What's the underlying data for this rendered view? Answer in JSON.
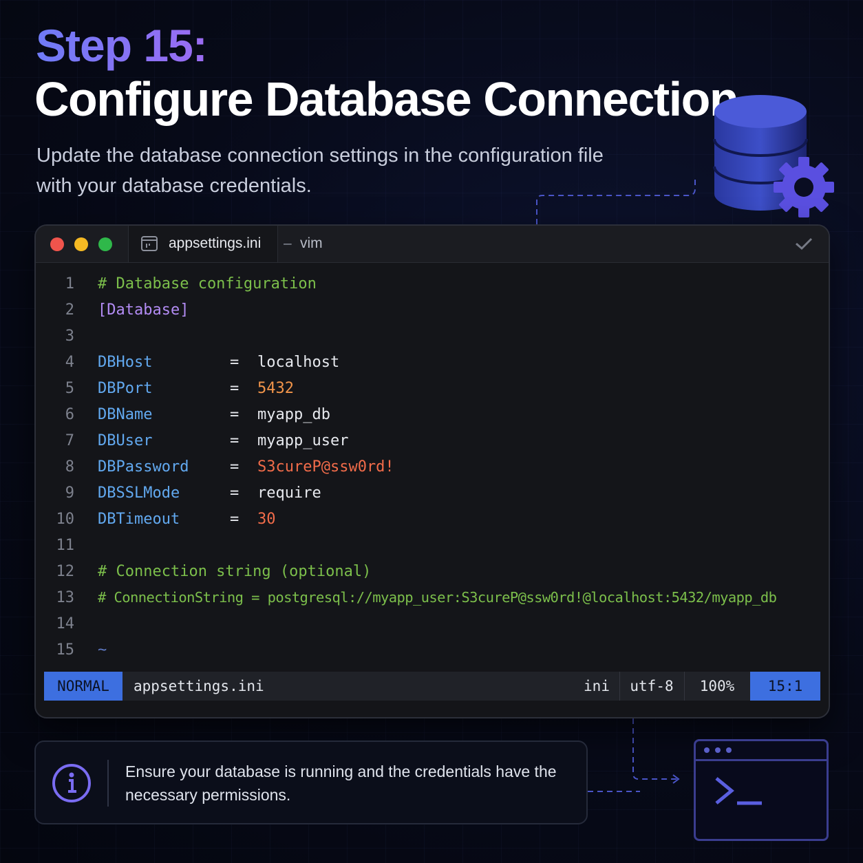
{
  "header": {
    "step": "Step 15:",
    "title": "Configure Database Connection",
    "subtitle": "Update the database connection settings in the configuration file with your database credentials."
  },
  "editor": {
    "tab_label": "appsettings.ini",
    "tab_separator": "–",
    "app_name": "vim",
    "lines": [
      {
        "n": "1",
        "text": "# Database configuration"
      },
      {
        "n": "2",
        "text": "[Database]"
      },
      {
        "n": "3",
        "text": ""
      },
      {
        "n": "4",
        "key": "DBHost",
        "eq": "=",
        "value": "localhost"
      },
      {
        "n": "5",
        "key": "DBPort",
        "eq": "=",
        "value": "5432"
      },
      {
        "n": "6",
        "key": "DBName",
        "eq": "=",
        "value": "myapp_db"
      },
      {
        "n": "7",
        "key": "DBUser",
        "eq": "=",
        "value": "myapp_user"
      },
      {
        "n": "8",
        "key": "DBPassword",
        "eq": "=",
        "value": "S3cureP@ssw0rd!"
      },
      {
        "n": "9",
        "key": "DBSSLMode",
        "eq": "=",
        "value": "require"
      },
      {
        "n": "10",
        "key": "DBTimeout",
        "eq": "=",
        "value": "30"
      },
      {
        "n": "11",
        "text": ""
      },
      {
        "n": "12",
        "text": "# Connection string (optional)"
      },
      {
        "n": "13",
        "text": "# ConnectionString = postgresql://myapp_user:S3cureP@ssw0rd!@localhost:5432/myapp_db"
      },
      {
        "n": "14",
        "text": ""
      },
      {
        "n": "15",
        "text": "~"
      }
    ],
    "status": {
      "mode": "NORMAL",
      "file": "appsettings.ini",
      "filetype": "ini",
      "encoding": "utf-8",
      "percent": "100%",
      "position": "15:1"
    }
  },
  "note": {
    "text": "Ensure your database is running and the credentials have the necessary permissions."
  },
  "colors": {
    "accent": "#7f6cf4",
    "key": "#62a9f0",
    "comment": "#7cbf4b",
    "number": "#f2954a",
    "string": "#f26c4a",
    "mode_bg": "#3d6fe0"
  },
  "icons": [
    "database-gear-icon",
    "file-icon",
    "check-icon",
    "info-icon",
    "terminal-icon"
  ]
}
